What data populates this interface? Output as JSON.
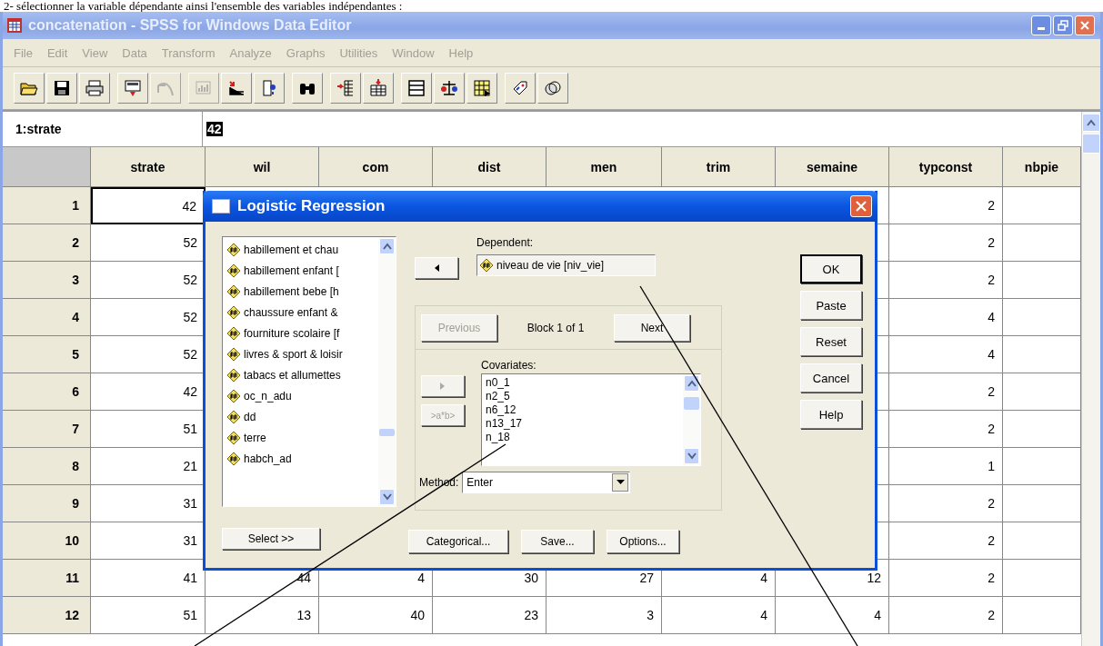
{
  "caption": "2- sélectionner la variable dépendante ainsi l'ensemble des variables indépendantes :",
  "window": {
    "title": "concatenation - SPSS for Windows Data Editor"
  },
  "menu": [
    {
      "label": "File",
      "disabled": true
    },
    {
      "label": "Edit",
      "disabled": true
    },
    {
      "label": "View",
      "disabled": true
    },
    {
      "label": "Data",
      "disabled": true
    },
    {
      "label": "Transform",
      "disabled": true
    },
    {
      "label": "Analyze",
      "disabled": true
    },
    {
      "label": "Graphs",
      "disabled": true
    },
    {
      "label": "Utilities",
      "disabled": true
    },
    {
      "label": "Window",
      "disabled": true
    },
    {
      "label": "Help",
      "disabled": true
    }
  ],
  "toolbar": [
    [
      {
        "kind": "open",
        "disabled": false
      },
      {
        "kind": "save",
        "disabled": false
      },
      {
        "kind": "print",
        "disabled": false
      }
    ],
    [
      {
        "kind": "recall",
        "disabled": false
      },
      {
        "kind": "undo",
        "disabled": true
      }
    ],
    [
      {
        "kind": "chart",
        "disabled": true
      },
      {
        "kind": "goto",
        "disabled": false
      },
      {
        "kind": "info",
        "disabled": false
      }
    ],
    [
      {
        "kind": "find",
        "disabled": false
      }
    ],
    [
      {
        "kind": "insert_row",
        "disabled": false
      },
      {
        "kind": "insert_column",
        "disabled": false
      }
    ],
    [
      {
        "kind": "split",
        "disabled": false
      },
      {
        "kind": "weight",
        "disabled": false
      },
      {
        "kind": "select",
        "disabled": false
      }
    ],
    [
      {
        "kind": "labels",
        "disabled": false
      },
      {
        "kind": "sets",
        "disabled": false
      }
    ]
  ],
  "editor": {
    "cell": "1:strate",
    "value": "42"
  },
  "columns": [
    "strate",
    "wil",
    "com",
    "dist",
    "men",
    "trim",
    "semaine",
    "typconst",
    "nbpie"
  ],
  "rows": [
    {
      "number": "1",
      "selected": true,
      "cells": [
        "42"
      ],
      "trailing_cells": [
        "2"
      ]
    },
    {
      "number": "2",
      "selected": false,
      "cells": [
        "52"
      ],
      "trailing_cells": [
        "2"
      ]
    },
    {
      "number": "3",
      "selected": false,
      "cells": [
        "52"
      ],
      "trailing_cells": [
        "2"
      ]
    },
    {
      "number": "4",
      "selected": false,
      "cells": [
        "52"
      ],
      "trailing_cells": [
        "4"
      ]
    },
    {
      "number": "5",
      "selected": false,
      "cells": [
        "52"
      ],
      "trailing_cells": [
        "4"
      ]
    },
    {
      "number": "6",
      "selected": false,
      "cells": [
        "42"
      ],
      "trailing_cells": [
        "2"
      ]
    },
    {
      "number": "7",
      "selected": false,
      "cells": [
        "51"
      ],
      "trailing_cells": [
        "2"
      ]
    },
    {
      "number": "8",
      "selected": false,
      "cells": [
        "21"
      ],
      "trailing_cells": [
        "1"
      ]
    },
    {
      "number": "9",
      "selected": false,
      "cells": [
        "31"
      ],
      "trailing_cells": [
        "2"
      ]
    },
    {
      "number": "10",
      "selected": false,
      "cells": [
        "31"
      ],
      "trailing_cells": [
        "2"
      ]
    },
    {
      "number": "11",
      "selected": false,
      "cells": [
        "41",
        "44",
        "4",
        "30",
        "27",
        "4",
        "12",
        "2"
      ]
    },
    {
      "number": "12",
      "selected": false,
      "cells": [
        "51",
        "13",
        "40",
        "23",
        "3",
        "4",
        "4",
        "2"
      ]
    }
  ],
  "dialog": {
    "title": "Logistic Regression",
    "variables": [
      "habillement et chau",
      "habillement enfant [",
      "habillement bebe [h",
      "chaussure enfant &",
      "fourniture scolaire [f",
      "livres & sport & loisir",
      "tabacs et allumettes",
      "oc_n_adu",
      "dd",
      "terre",
      "habch_ad"
    ],
    "dependent_label": "Dependent:",
    "dependent": "niveau de vie [niv_vie]",
    "previous": {
      "label": "Previous",
      "disabled": true
    },
    "block": "Block 1 of 1",
    "next": {
      "label": "Next",
      "disabled": false
    },
    "covariates_label": "Covariates:",
    "covariates": [
      "n0_1",
      "n2_5",
      "n6_12",
      "n13_17",
      "n_18"
    ],
    "covariate_arrow_disabled": true,
    "interaction": {
      "label": ">a*b>",
      "disabled": true
    },
    "method_label": "Method:",
    "method": "Enter",
    "select_button": "Select >>",
    "bottom_buttons": [
      "Categorical...",
      "Save...",
      "Options..."
    ],
    "side_buttons": [
      {
        "label": "OK",
        "default": true
      },
      {
        "label": "Paste",
        "default": false
      },
      {
        "label": "Reset",
        "default": false
      },
      {
        "label": "Cancel",
        "default": false
      },
      {
        "label": "Help",
        "default": false
      }
    ]
  }
}
